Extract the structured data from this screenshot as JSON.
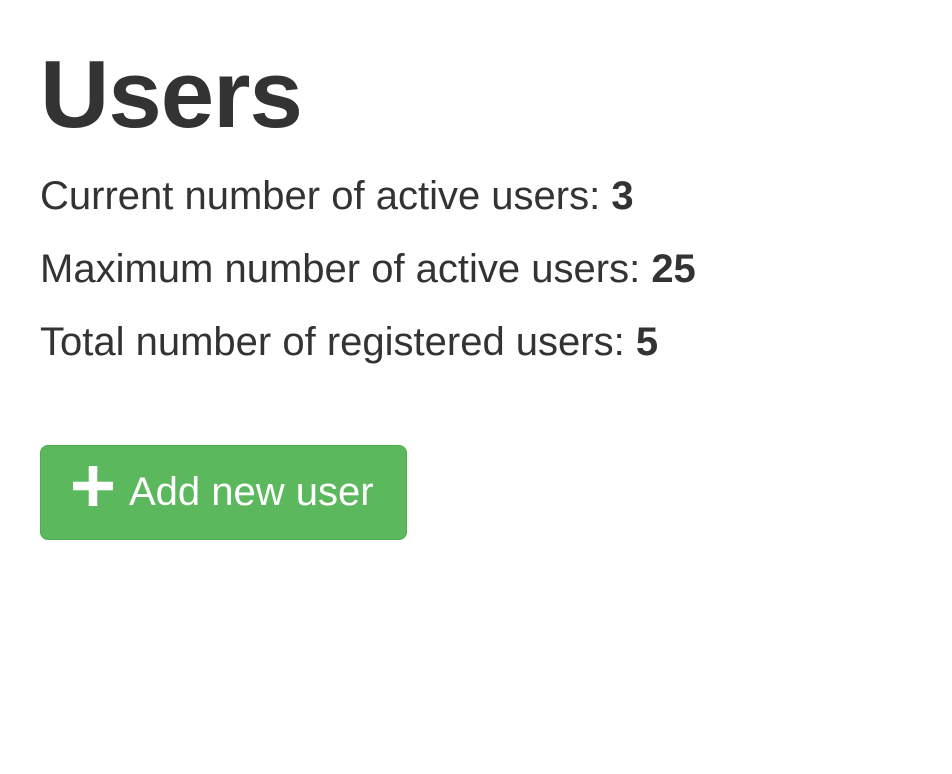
{
  "header": {
    "title": "Users"
  },
  "stats": {
    "active_label": "Current number of active users: ",
    "active_value": "3",
    "max_label": "Maximum number of active users: ",
    "max_value": "25",
    "total_label": "Total number of registered users: ",
    "total_value": "5"
  },
  "actions": {
    "add_user_label": "Add new user"
  }
}
